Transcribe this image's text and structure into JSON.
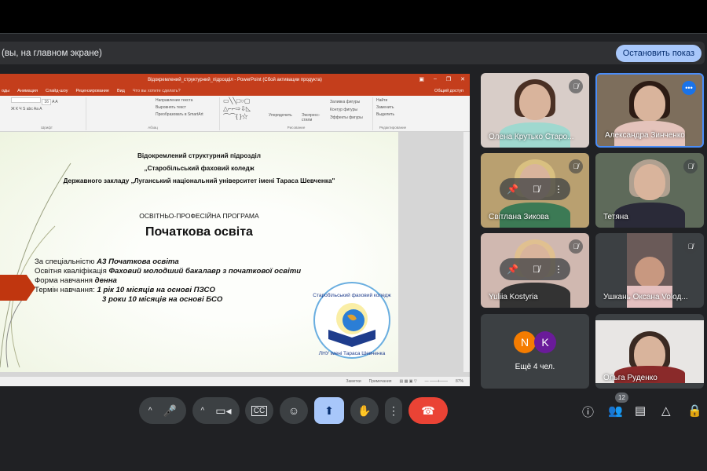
{
  "banner": {
    "text": "(вы, на главном экране)",
    "stop_label": "Остановить показ"
  },
  "ppt": {
    "title": "Відокремлений_структурний_підрозділ - PowerPoint (Сбой активации продукта)",
    "tabs": [
      "оды",
      "Анимация",
      "Слайд-шоу",
      "Рецензирование",
      "Вид",
      "Что вы хотите сделать?"
    ],
    "share": "Общий доступ",
    "font_size": "16",
    "groups": {
      "font": "Шрифт",
      "paragraph": "Абзац",
      "drawing": "Рисование",
      "editing": "Редактирование"
    },
    "para_items": [
      "Направление текста",
      "Выровнять текст",
      "Преобразовать в SmartArt"
    ],
    "draw_items": [
      "Упорядочить",
      "Экспресс-стили",
      "Заливка фигуры",
      "Контур фигуры",
      "Эффекты фигуры"
    ],
    "edit_items": [
      "Найти",
      "Заменить",
      "Выделить"
    ],
    "status": {
      "notes": "Заметки",
      "comments": "Примечания",
      "zoom": "87%"
    }
  },
  "slide": {
    "line1": "Відокремлений структурний підрозділ",
    "line2": "„Старобільський фаховий коледж",
    "line3": "Державного закладу „Луганський національний університет імені Тараса Шевченка\"",
    "program": "ОСВІТНЬО-ПРОФЕСІЙНА ПРОГРАМА",
    "heading": "Початкова освіта",
    "rows": [
      {
        "label": "За спеціальністю ",
        "value": "А3 Початкова освіта"
      },
      {
        "label": "Освітня кваліфікація ",
        "value": "Фаховий молодший бакалавр з початкової освіти"
      },
      {
        "label": "Форма навчання ",
        "value": "денна"
      },
      {
        "label": "Термін навчання:  ",
        "value": "1 рік 10 місяців на основі ПЗСО"
      },
      {
        "label": "",
        "value": "3 роки 10 місяців на основі БСО"
      }
    ],
    "logo_text": "Старобільський фаховий коледж ЛНУ імені Тараса Шевченка"
  },
  "participants": [
    {
      "name": "Олена Крутько Старо..."
    },
    {
      "name": "Александра Зинченко"
    },
    {
      "name": "Світлана Зикова"
    },
    {
      "name": "Тетяна"
    },
    {
      "name": "Yuliia Kostyria"
    },
    {
      "name": "Ушкань Оксана Volод..."
    },
    {
      "name": "Ещё 4 чел.",
      "avatars": [
        "N",
        "K"
      ]
    },
    {
      "name": "Ольга Руденко"
    }
  ],
  "toolbar": {
    "participants_count": "12"
  },
  "colors": {
    "accent": "#a8c7fa",
    "end_call": "#ea4335",
    "ppt": "#c43e1c",
    "speaking": "#4a8df8"
  }
}
